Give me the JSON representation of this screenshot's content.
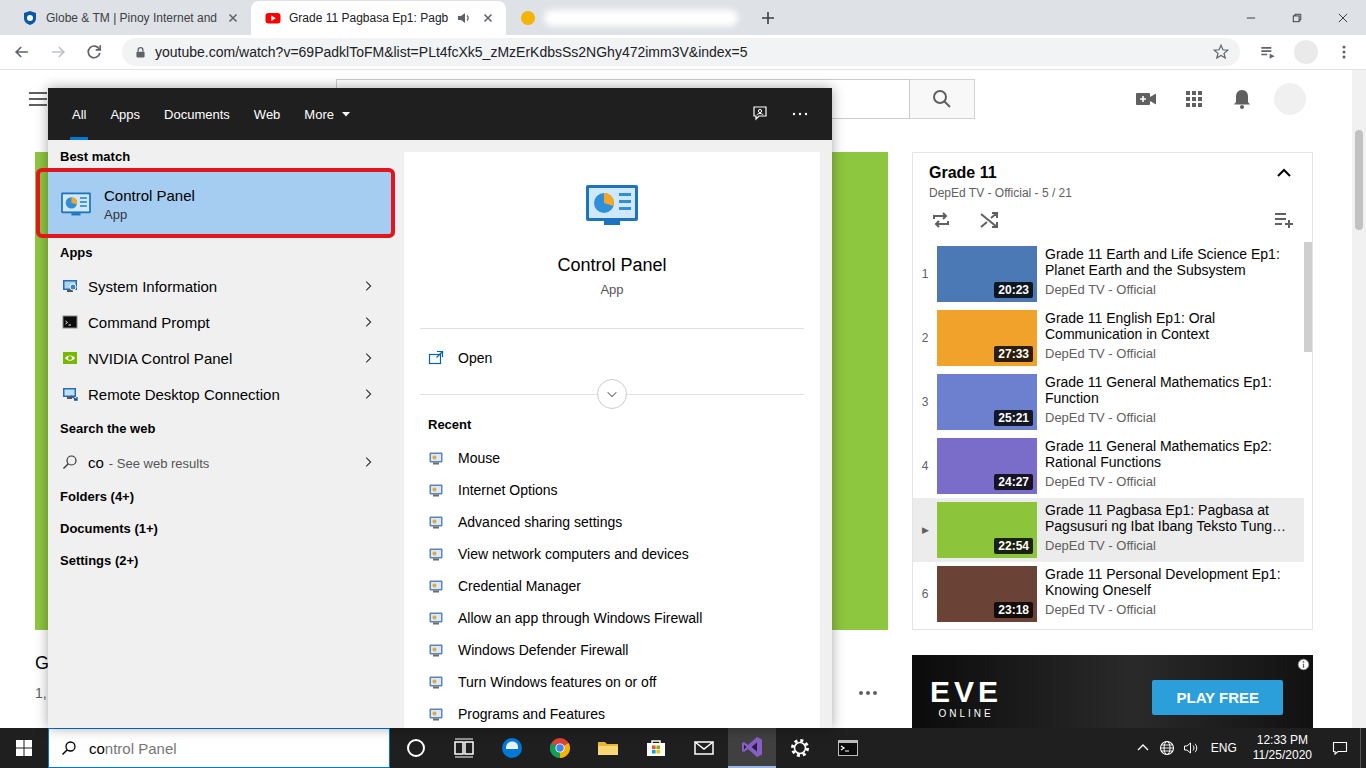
{
  "browser": {
    "tabs": [
      {
        "title": "Globe & TM | Pinoy Internet and",
        "kind": "site",
        "selected": false,
        "audio": false,
        "redacted": false
      },
      {
        "title": "Grade 11 Pagbasa Ep1: Pagb",
        "kind": "video",
        "selected": true,
        "audio": true,
        "redacted": false
      },
      {
        "kind": "hidden",
        "selected": false,
        "audio": false,
        "redacted": true
      }
    ],
    "url": "youtube.com/watch?v=69PadklToFM&list=PLt4fcXk5_zMzErKdbsSs2NGhy472imm3V&index=5"
  },
  "youtube": {
    "video": {
      "title": "G",
      "views": "1,"
    },
    "playlist": {
      "title": "Grade 11",
      "subtitle": "DepEd TV - Official - 5 / 21",
      "playing_marker": "▶",
      "items": [
        {
          "index": "1",
          "title": "Grade 11 Earth and Life Science Ep1: Planet Earth and the Subsystem",
          "channel": "DepEd TV - Official",
          "duration": "20:23",
          "selected": false
        },
        {
          "index": "2",
          "title": "Grade 11 English Ep1: Oral Communication in Context",
          "channel": "DepEd TV - Official",
          "duration": "27:33",
          "selected": false
        },
        {
          "index": "3",
          "title": "Grade 11 General Mathematics Ep1: Function",
          "channel": "DepEd TV - Official",
          "duration": "25:21",
          "selected": false
        },
        {
          "index": "4",
          "title": "Grade 11 General Mathematics Ep2: Rational Functions",
          "channel": "DepEd TV - Official",
          "duration": "24:27",
          "selected": false
        },
        {
          "title": "Grade 11 Pagbasa Ep1: Pagbasa at Pagsusuri ng Ibat Ibang Teksto Tung…",
          "channel": "DepEd TV - Official",
          "duration": "22:54",
          "selected": true
        },
        {
          "index": "6",
          "title": "Grade 11 Personal Development Ep1: Knowing Oneself",
          "channel": "DepEd TV - Official",
          "duration": "23:18",
          "selected": false
        }
      ]
    },
    "ad": {
      "headline": "EVE",
      "subline": "ONLINE",
      "cta": "PLAY FREE"
    }
  },
  "start_menu": {
    "tabs": [
      {
        "label": "All",
        "selected": true,
        "dropdown": false
      },
      {
        "label": "Apps",
        "selected": false,
        "dropdown": false
      },
      {
        "label": "Documents",
        "selected": false,
        "dropdown": false
      },
      {
        "label": "Web",
        "selected": false,
        "dropdown": false
      },
      {
        "label": "More",
        "selected": false,
        "dropdown": true
      }
    ],
    "best_match": {
      "heading": "Best match",
      "name": "Control Panel",
      "type": "App",
      "selected": true,
      "annotated": true
    },
    "apps": {
      "heading": "Apps",
      "items": [
        {
          "name": "System Information",
          "kind": "sysinfo"
        },
        {
          "name": "Command Prompt",
          "kind": "cmd"
        },
        {
          "name": "NVIDIA Control Panel",
          "kind": "nvidia"
        },
        {
          "name": "Remote Desktop Connection",
          "kind": "rdp"
        }
      ]
    },
    "web": {
      "heading": "Search the web",
      "query": "co",
      "hint": "- See web results"
    },
    "groups": [
      "Folders (4+)",
      "Documents (1+)",
      "Settings (2+)"
    ],
    "preview": {
      "name": "Control Panel",
      "type": "App",
      "action": "Open",
      "recent_heading": "Recent",
      "recent": [
        "Mouse",
        "Internet Options",
        "Advanced sharing settings",
        "View network computers and devices",
        "Credential Manager",
        "Allow an app through Windows Firewall",
        "Windows Defender Firewall",
        "Turn Windows features on or off",
        "Programs and Features"
      ]
    }
  },
  "taskbar": {
    "search": {
      "typed": "co",
      "suggestion": "ntrol Panel"
    },
    "apps": [
      {
        "kind": "cortana",
        "active": false
      },
      {
        "kind": "taskview",
        "active": false
      },
      {
        "kind": "edge",
        "active": false
      },
      {
        "kind": "chrome",
        "active": false
      },
      {
        "kind": "explorer",
        "active": false
      },
      {
        "kind": "store",
        "active": false
      },
      {
        "kind": "mail",
        "active": false
      },
      {
        "kind": "vstudio",
        "active": true
      },
      {
        "kind": "settings",
        "active": false
      },
      {
        "kind": "terminal",
        "active": false
      }
    ],
    "tray": {
      "language": "ENG",
      "time": "12:33 PM",
      "date": "11/25/2020"
    }
  }
}
